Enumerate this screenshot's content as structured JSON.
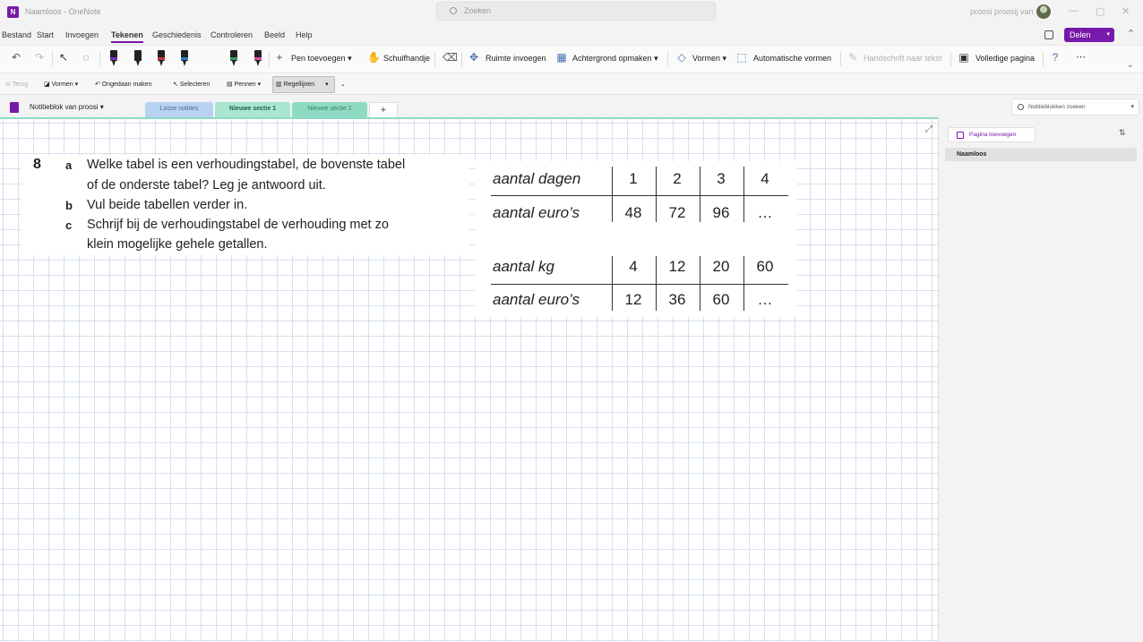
{
  "window": {
    "title": "Naamloos - OneNote",
    "search_placeholder": "Zoeken",
    "user": "proosi proosij van",
    "minimize": "—",
    "maximize": "▢",
    "close": "✕"
  },
  "menu": {
    "items": [
      "Bestand",
      "Start",
      "Invoegen",
      "Tekenen",
      "Geschiedenis",
      "Controleren",
      "Beeld",
      "Help"
    ],
    "active": "Tekenen",
    "share_label": "Delen"
  },
  "ribbon": {
    "pen_add": "Pen toevoegen",
    "hand": "Schuifhandje",
    "insert_space": "Ruimte invoegen",
    "background": "Achtergrond opmaken",
    "shapes": "Vormen",
    "auto_shapes": "Automatische vormen",
    "ink_to_text": "Handschrift naar tekst",
    "full_page": "Volledige pagina",
    "more": "⋯"
  },
  "ribbon2": {
    "back": "Terug",
    "shapes": "Vormen",
    "undo": "Ongedaan maken",
    "select": "Selecteren",
    "pens": "Pennen",
    "ruler": "Regellijnen"
  },
  "notebook": {
    "name": "Notitieblok van proosi",
    "search_placeholder": "Notitieblokken zoeken",
    "tabs": [
      {
        "label": "Losse notities",
        "color": "#b8d3f2"
      },
      {
        "label": "Nieuwe sectie 1",
        "color": "#a8e6d2"
      },
      {
        "label": "Nieuwe sectie 2",
        "color": "#8edbc4"
      }
    ],
    "add_tab": "+"
  },
  "exercise": {
    "number": "8",
    "parts": [
      {
        "letter": "a",
        "lines": [
          "Welke tabel is een verhoudingstabel, de bovenste tabel",
          "of de onderste tabel? Leg je antwoord uit."
        ]
      },
      {
        "letter": "b",
        "lines": [
          "Vul beide tabellen verder in."
        ]
      },
      {
        "letter": "c",
        "lines": [
          "Schrijf bij de verhoudingstabel de verhouding met zo",
          "klein mogelijke gehele getallen."
        ]
      }
    ]
  },
  "tables": [
    {
      "rows": [
        {
          "label": "aantal dagen",
          "values": [
            "1",
            "2",
            "3",
            "4"
          ]
        },
        {
          "label": "aantal euro’s",
          "values": [
            "48",
            "72",
            "96",
            "…"
          ]
        }
      ]
    },
    {
      "rows": [
        {
          "label": "aantal kg",
          "values": [
            "4",
            "12",
            "20",
            "60"
          ]
        },
        {
          "label": "aantal euro’s",
          "values": [
            "12",
            "36",
            "60",
            "…"
          ]
        }
      ]
    }
  ],
  "pages": {
    "add_label": "Pagina toevoegen",
    "items": [
      "Naamloos"
    ]
  }
}
